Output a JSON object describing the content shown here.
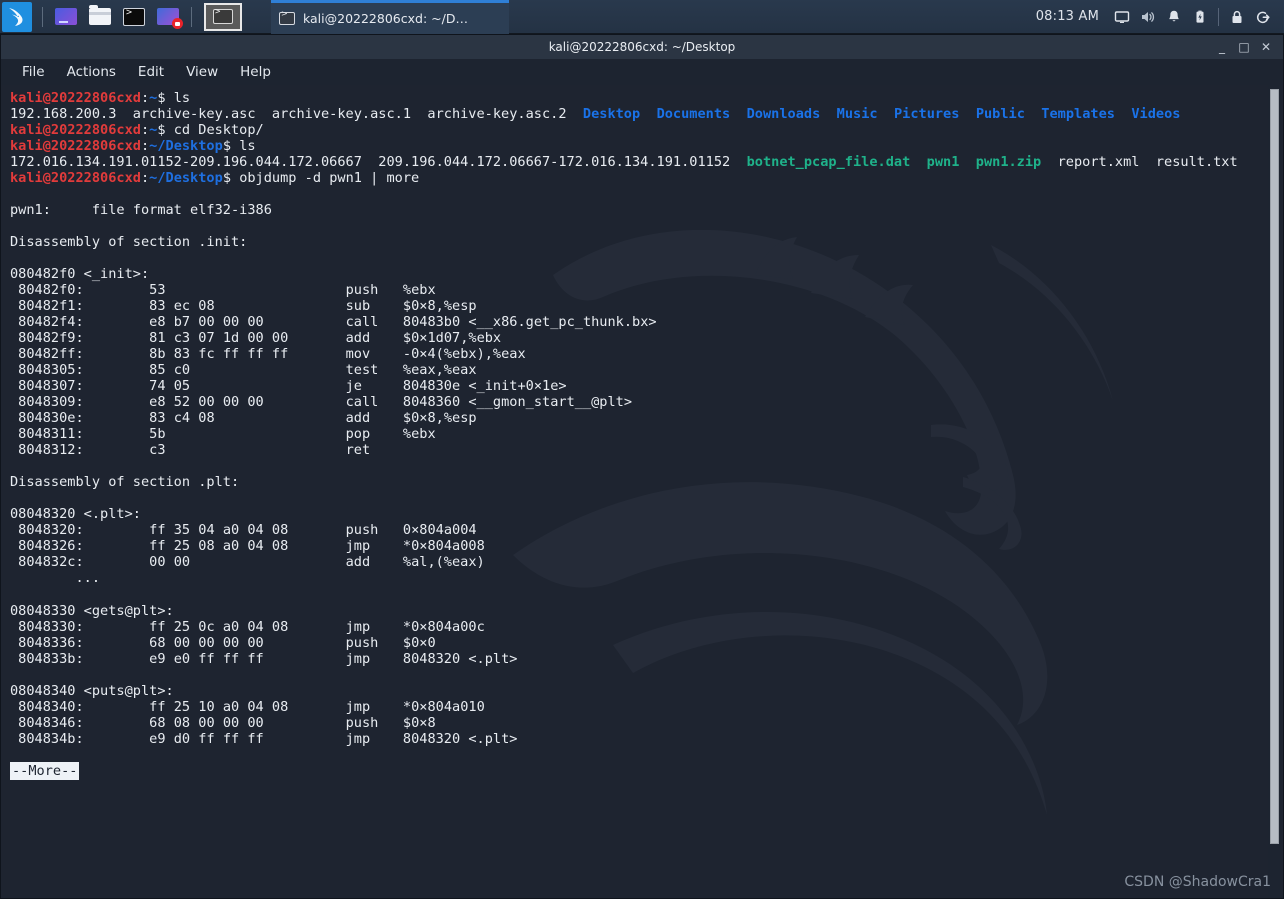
{
  "taskbar": {
    "logo_name": "kali-dragon-logo",
    "launchers": [
      {
        "name": "web-browser-icon",
        "label": "Web Browser"
      },
      {
        "name": "file-manager-icon",
        "label": "File Manager"
      },
      {
        "name": "terminal-icon",
        "label": "Terminal"
      },
      {
        "name": "screen-recorder-icon",
        "label": "Screen Recorder"
      }
    ],
    "active_app_label": "Terminal",
    "window_button": {
      "title": "kali@20222806cxd: ~/D…",
      "icon": "terminal-icon"
    },
    "tray": {
      "clock": "08:13 AM",
      "icons": [
        {
          "name": "display-icon",
          "label": "Display"
        },
        {
          "name": "volume-icon",
          "label": "Volume"
        },
        {
          "name": "notification-bell-icon",
          "label": "Notifications"
        },
        {
          "name": "battery-icon",
          "label": "Battery"
        },
        {
          "name": "lock-icon",
          "label": "Lock Screen"
        },
        {
          "name": "logout-icon",
          "label": "Log Out"
        }
      ]
    }
  },
  "window": {
    "title": "kali@20222806cxd: ~/Desktop",
    "controls": {
      "minimize": "_",
      "maximize": "□",
      "close": "✕"
    },
    "menu": [
      "File",
      "Actions",
      "Edit",
      "View",
      "Help"
    ]
  },
  "terminal": {
    "prompt_user": "kali@20222806cxd",
    "prompt_home": "~",
    "prompt_desktop": "~/Desktop",
    "commands": {
      "cmd1": "ls",
      "cmd2": "cd Desktop/",
      "cmd3": "ls",
      "cmd4": "objdump -d pwn1 | more"
    },
    "ls_home_plain": "192.168.200.3  archive-key.asc  archive-key.asc.1  archive-key.asc.2  ",
    "ls_home_dirs": [
      "Desktop",
      "Documents",
      "Downloads",
      "Music",
      "Pictures",
      "Public",
      "Templates",
      "Videos"
    ],
    "ls_desktop_plain1": "172.016.134.191.01152-209.196.044.172.06667  209.196.044.172.06667-172.016.134.191.01152  ",
    "ls_desktop_green": [
      "botnet_pcap_file.dat",
      "pwn1",
      "pwn1.zip"
    ],
    "ls_desktop_plain2": "report.xml  result.txt",
    "file_format_line": "pwn1:     file format elf32-i386",
    "section_init_header": "Disassembly of section .init:",
    "init_label": "080482f0 <_init>:",
    "init_rows": [
      {
        "addr": " 80482f0:",
        "bytes": "53",
        "mnem": "push",
        "ops": "%ebx"
      },
      {
        "addr": " 80482f1:",
        "bytes": "83 ec 08",
        "mnem": "sub",
        "ops": "$0×8,%esp"
      },
      {
        "addr": " 80482f4:",
        "bytes": "e8 b7 00 00 00",
        "mnem": "call",
        "ops": "80483b0 <__x86.get_pc_thunk.bx>"
      },
      {
        "addr": " 80482f9:",
        "bytes": "81 c3 07 1d 00 00",
        "mnem": "add",
        "ops": "$0×1d07,%ebx"
      },
      {
        "addr": " 80482ff:",
        "bytes": "8b 83 fc ff ff ff",
        "mnem": "mov",
        "ops": "-0×4(%ebx),%eax"
      },
      {
        "addr": " 8048305:",
        "bytes": "85 c0",
        "mnem": "test",
        "ops": "%eax,%eax"
      },
      {
        "addr": " 8048307:",
        "bytes": "74 05",
        "mnem": "je",
        "ops": "804830e <_init+0×1e>"
      },
      {
        "addr": " 8048309:",
        "bytes": "e8 52 00 00 00",
        "mnem": "call",
        "ops": "8048360 <__gmon_start__@plt>"
      },
      {
        "addr": " 804830e:",
        "bytes": "83 c4 08",
        "mnem": "add",
        "ops": "$0×8,%esp"
      },
      {
        "addr": " 8048311:",
        "bytes": "5b",
        "mnem": "pop",
        "ops": "%ebx"
      },
      {
        "addr": " 8048312:",
        "bytes": "c3",
        "mnem": "ret",
        "ops": ""
      }
    ],
    "section_plt_header": "Disassembly of section .plt:",
    "plt_label": "08048320 <.plt>:",
    "plt_rows": [
      {
        "addr": " 8048320:",
        "bytes": "ff 35 04 a0 04 08",
        "mnem": "push",
        "ops": "0×804a004"
      },
      {
        "addr": " 8048326:",
        "bytes": "ff 25 08 a0 04 08",
        "mnem": "jmp",
        "ops": "*0×804a008"
      },
      {
        "addr": " 804832c:",
        "bytes": "00 00",
        "mnem": "add",
        "ops": "%al,(%eax)"
      }
    ],
    "plt_ellipsis": "        ...",
    "gets_label": "08048330 <gets@plt>:",
    "gets_rows": [
      {
        "addr": " 8048330:",
        "bytes": "ff 25 0c a0 04 08",
        "mnem": "jmp",
        "ops": "*0×804a00c"
      },
      {
        "addr": " 8048336:",
        "bytes": "68 00 00 00 00",
        "mnem": "push",
        "ops": "$0×0"
      },
      {
        "addr": " 804833b:",
        "bytes": "e9 e0 ff ff ff",
        "mnem": "jmp",
        "ops": "8048320 <.plt>"
      }
    ],
    "puts_label": "08048340 <puts@plt>:",
    "puts_rows": [
      {
        "addr": " 8048340:",
        "bytes": "ff 25 10 a0 04 08",
        "mnem": "jmp",
        "ops": "*0×804a010"
      },
      {
        "addr": " 8048346:",
        "bytes": "68 08 00 00 00",
        "mnem": "push",
        "ops": "$0×8"
      },
      {
        "addr": " 804834b:",
        "bytes": "e9 d0 ff ff ff",
        "mnem": "jmp",
        "ops": "8048320 <.plt>"
      }
    ],
    "more_prompt": "--More--"
  },
  "watermark": "CSDN @ShadowCra1",
  "colors": {
    "prompt_user": "#e23b3b",
    "prompt_path": "#1e6fe0",
    "directory": "#1a72e8",
    "archive": "#1fb28a",
    "terminal_bg": "#1e2430",
    "panel_bg": "#29394d"
  }
}
